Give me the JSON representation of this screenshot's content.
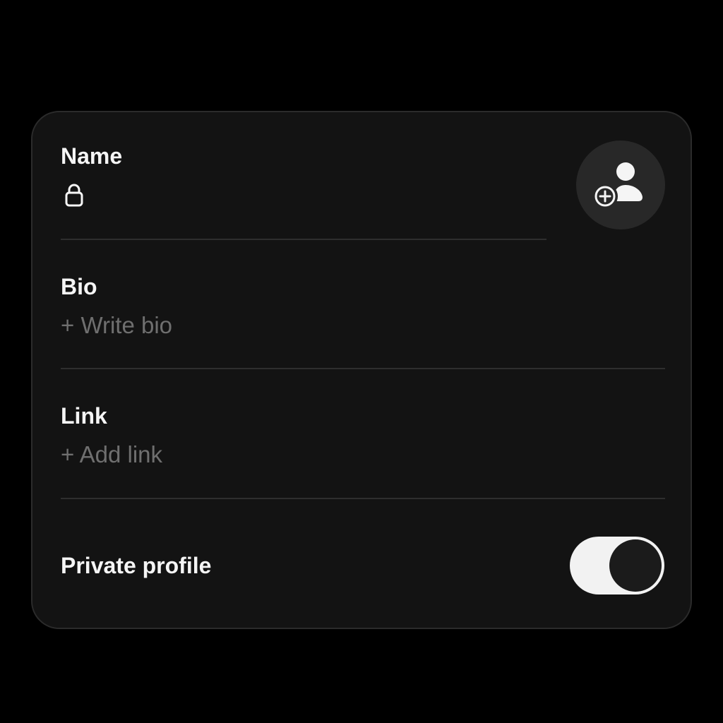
{
  "profile_form": {
    "name": {
      "label": "Name",
      "icon": "lock-icon"
    },
    "avatar": {
      "icon": "add-person-icon"
    },
    "bio": {
      "label": "Bio",
      "placeholder": "+ Write bio"
    },
    "link": {
      "label": "Link",
      "placeholder": "+ Add link"
    },
    "private_profile": {
      "label": "Private profile",
      "enabled": true
    }
  },
  "colors": {
    "background": "#000000",
    "card": "#131313",
    "text": "#f5f5f5",
    "placeholder": "#6f6f6f",
    "toggle_track": "#f2f2f2",
    "toggle_knob": "#1b1b1b"
  }
}
